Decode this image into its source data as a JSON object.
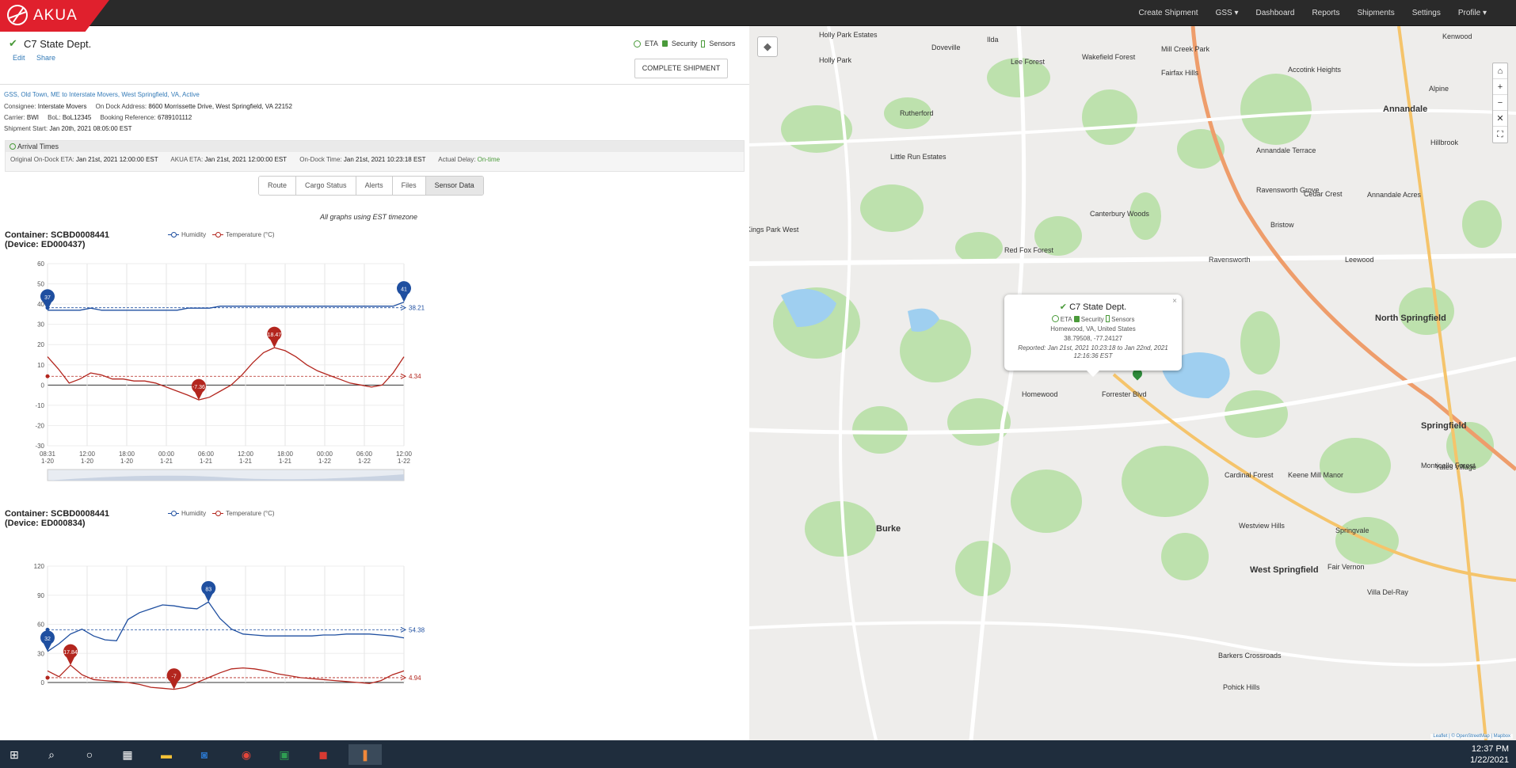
{
  "app": {
    "logo": "AKUA"
  },
  "nav": [
    "Create Shipment",
    "GSS ▾",
    "Dashboard",
    "Reports",
    "Shipments",
    "Settings",
    "Profile ▾"
  ],
  "shipment": {
    "title": "C7 State Dept.",
    "edit": "Edit",
    "share": "Share",
    "status_eta": "ETA",
    "status_security": "Security",
    "status_sensors": "Sensors",
    "complete_button": "COMPLETE SHIPMENT",
    "route_line": "GSS, Old Town, ME to Interstate Movers, West Springfield, VA, Active",
    "consignee_label": "Consignee:",
    "consignee": "Interstate Movers",
    "ondock_label": "On Dock Address:",
    "ondock": "8600 Morrissette Drive, West Springfield, VA 22152",
    "carrier_label": "Carrier:",
    "carrier": "BWI",
    "bol_label": "BoL:",
    "bol": "BoL12345",
    "booking_label": "Booking Reference:",
    "booking": "6789101112",
    "start_label": "Shipment Start:",
    "start": "Jan 20th, 2021 08:05:00 EST"
  },
  "arrival": {
    "heading": "Arrival Times",
    "orig_label": "Original On-Dock ETA:",
    "orig": "Jan 21st, 2021 12:00:00 EST",
    "akua_label": "AKUA ETA:",
    "akua": "Jan 21st, 2021 12:00:00 EST",
    "dock_label": "On-Dock Time:",
    "dock": "Jan 21st, 2021 10:23:18 EST",
    "delay_label": "Actual Delay:",
    "delay": "On-time"
  },
  "tabs": [
    "Route",
    "Cargo Status",
    "Alerts",
    "Files",
    "Sensor Data"
  ],
  "tz_note": "All graphs using EST timezone",
  "legend": {
    "humidity": "Humidity",
    "temperature": "Temperature (°C)"
  },
  "colors": {
    "humidity": "#1f4fa0",
    "temperature": "#b3261e",
    "brand": "#e0202d"
  },
  "chart_data": [
    {
      "type": "line",
      "title": "Container: SCBD0008441",
      "subtitle": "(Device: ED000437)",
      "ylim": [
        -30,
        60
      ],
      "yticks": [
        -30,
        -20,
        -10,
        0,
        10,
        20,
        30,
        40,
        50,
        60
      ],
      "xtick_labels": [
        [
          "08:31",
          "1-20"
        ],
        [
          "12:00",
          "1-20"
        ],
        [
          "18:00",
          "1-20"
        ],
        [
          "00:00",
          "1-21"
        ],
        [
          "06:00",
          "1-21"
        ],
        [
          "12:00",
          "1-21"
        ],
        [
          "18:00",
          "1-21"
        ],
        [
          "00:00",
          "1-22"
        ],
        [
          "06:00",
          "1-22"
        ],
        [
          "12:00",
          "1-22"
        ]
      ],
      "series": [
        {
          "name": "Humidity",
          "values": [
            37,
            37,
            37,
            37,
            38,
            37,
            37,
            37,
            37,
            37,
            37,
            37,
            37,
            38,
            38,
            38,
            39,
            39,
            39,
            39,
            39,
            39,
            39,
            39,
            39,
            39,
            39,
            39,
            39,
            39,
            39,
            39,
            39,
            41
          ],
          "avg": 38.21,
          "min_marker": {
            "i": 0,
            "label": "37"
          },
          "max_marker": {
            "i": 33,
            "label": "41"
          }
        },
        {
          "name": "Temperature (°C)",
          "values": [
            14,
            8,
            1,
            3,
            6,
            5,
            3,
            3,
            2,
            2,
            1,
            -1,
            -3,
            -5,
            -7.36,
            -6,
            -3,
            0,
            5,
            11,
            16,
            18.47,
            17,
            14,
            10,
            7,
            5,
            3,
            1,
            0,
            -1,
            0,
            6,
            14
          ],
          "avg": 4.34,
          "min_marker": {
            "i": 14,
            "label": "-7.36"
          },
          "max_marker": {
            "i": 21,
            "label": "18.47"
          }
        }
      ]
    },
    {
      "type": "line",
      "title": "Container: SCBD0008441",
      "subtitle": "(Device: ED000834)",
      "ylim": [
        0,
        120
      ],
      "yticks": [
        0,
        30,
        60,
        90,
        120
      ],
      "series": [
        {
          "name": "Humidity",
          "values": [
            32,
            40,
            50,
            55,
            48,
            44,
            43,
            65,
            72,
            76,
            80,
            79,
            77,
            76,
            83,
            66,
            55,
            50,
            49,
            48,
            48,
            48,
            48,
            48,
            49,
            49,
            50,
            50,
            50,
            49,
            48,
            46
          ],
          "avg": 54.38,
          "min_marker": {
            "i": 0,
            "label": "32"
          },
          "max_marker": {
            "i": 14,
            "label": "83"
          }
        },
        {
          "name": "Temperature (°C)",
          "values": [
            12,
            6,
            17.84,
            8,
            3,
            2,
            1,
            0,
            -2,
            -5,
            -6,
            -7,
            -5,
            0,
            5,
            10,
            14,
            15,
            14,
            12,
            9,
            7,
            5,
            4,
            3,
            2,
            1,
            0,
            -1,
            2,
            8,
            12
          ],
          "avg": 4.94,
          "min_marker": {
            "i": 11,
            "label": "-7"
          },
          "max_marker": {
            "i": 2,
            "label": "17.84"
          }
        }
      ]
    }
  ],
  "map": {
    "popup_title": "C7 State Dept.",
    "popup_eta": "ETA",
    "popup_security": "Security",
    "popup_sensors": "Sensors",
    "popup_location": "Homewood, VA, United States",
    "popup_coords": "38.79508, -77.24127",
    "popup_reported": "Reported: Jan 21st, 2021 10:23:18 to Jan 22nd, 2021 12:16:36 EST",
    "attribution": "Leaflet | © OpenStreetMap | Mapbox",
    "labels": [
      "Holly Park Estates",
      "Holly Park",
      "Ilda",
      "Doveville",
      "Lee Forest",
      "Wakefield Forest",
      "Mill Creek Park",
      "Fairfax Hills",
      "Kenwood",
      "Accotink Heights",
      "Annandale",
      "Alpine",
      "Rutherford",
      "Hillbrook",
      "Annandale Terrace",
      "Little Run Estates",
      "Ravensworth Grove",
      "Cedar Crest",
      "Annandale Acres",
      "Canterbury Woods",
      "Bristow",
      "Kings Park West",
      "Red Fox Forest",
      "Ravensworth",
      "Leewood",
      "North Springfield",
      "Homewood",
      "Forrester Blvd",
      "Cardinal Forest",
      "Keene Mill Manor",
      "Springfield",
      "Monticello Forest",
      "Yates Village",
      "Burke",
      "Westview Hills",
      "Springvale",
      "West Springfield",
      "Fair Vernon",
      "Villa Del-Ray",
      "Barkers Crossroads",
      "Pohick Hills"
    ]
  },
  "taskbar": {
    "time": "12:37 PM",
    "date": "1/22/2021"
  }
}
